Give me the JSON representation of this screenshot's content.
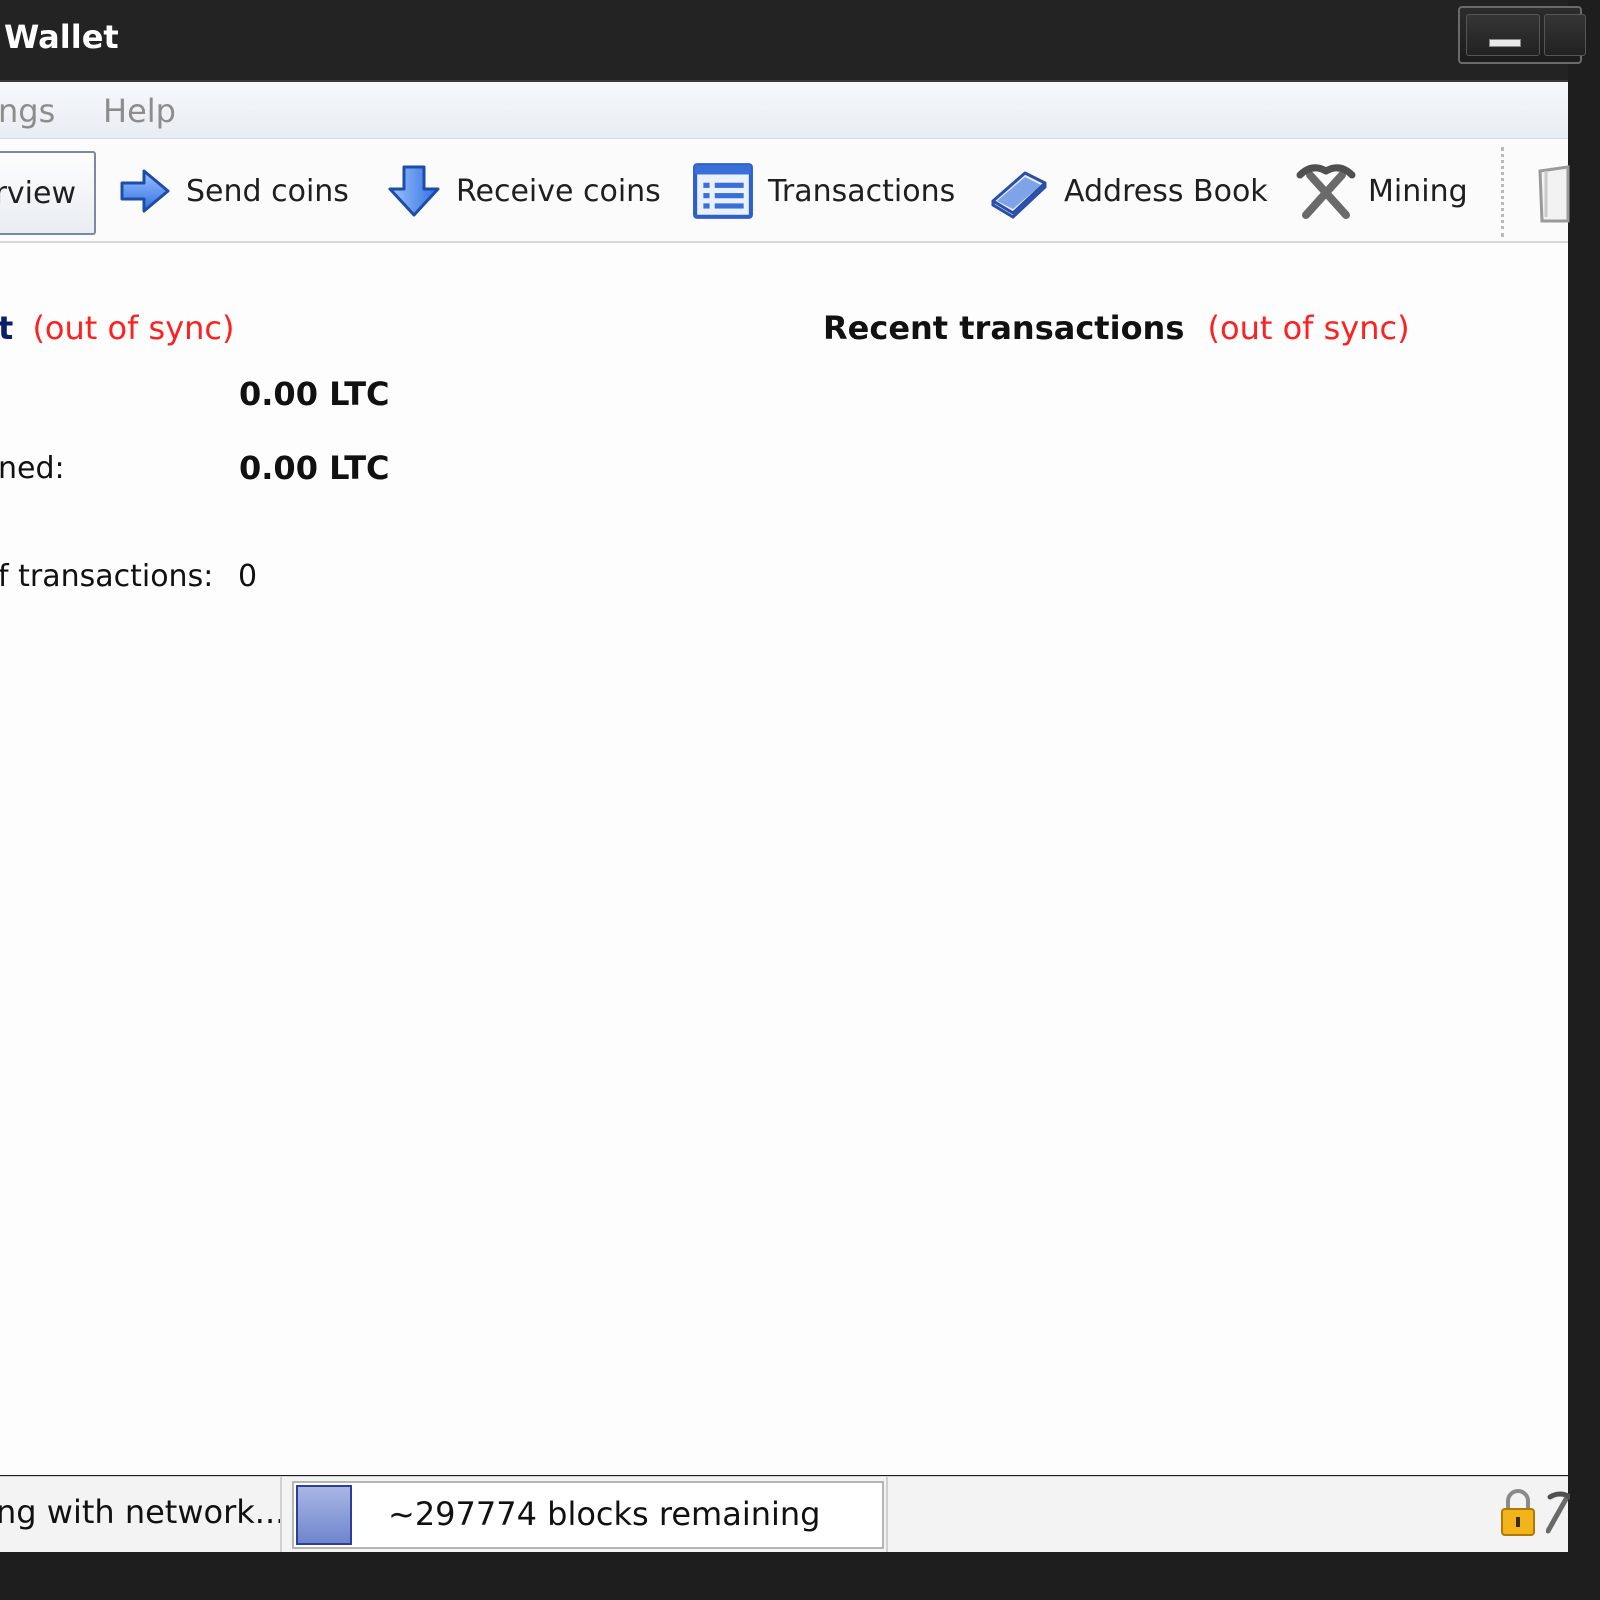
{
  "window": {
    "title": "Wallet"
  },
  "menu": {
    "items": [
      "ngs",
      "Help"
    ]
  },
  "toolbar": {
    "buttons": [
      {
        "label": "rview",
        "icon": "overview-icon",
        "active": true
      },
      {
        "label": "Send coins",
        "icon": "send-arrow-icon"
      },
      {
        "label": "Receive coins",
        "icon": "receive-arrow-icon"
      },
      {
        "label": "Transactions",
        "icon": "transactions-list-icon"
      },
      {
        "label": "Address Book",
        "icon": "address-book-icon"
      },
      {
        "label": "Mining",
        "icon": "pickaxe-icon"
      }
    ]
  },
  "overview": {
    "wallet_heading": "t",
    "out_of_sync": "(out of sync)",
    "balance_value": "0.00 LTC",
    "unconfirmed_label": "ned:",
    "unconfirmed_value": "0.00 LTC",
    "tx_count_label": "f transactions:",
    "tx_count_value": "0",
    "recent_heading": "Recent transactions",
    "recent_out_of_sync": "(out of sync)"
  },
  "status": {
    "sync_text": "ng with network...",
    "progress_text": "~297774 blocks remaining",
    "progress_fraction": 0.09
  },
  "colors": {
    "title_bg": "#232323",
    "out_of_sync": "#ff2020",
    "heading_blue": "#0c1f6b",
    "progress_fill": "#6f85cc"
  }
}
